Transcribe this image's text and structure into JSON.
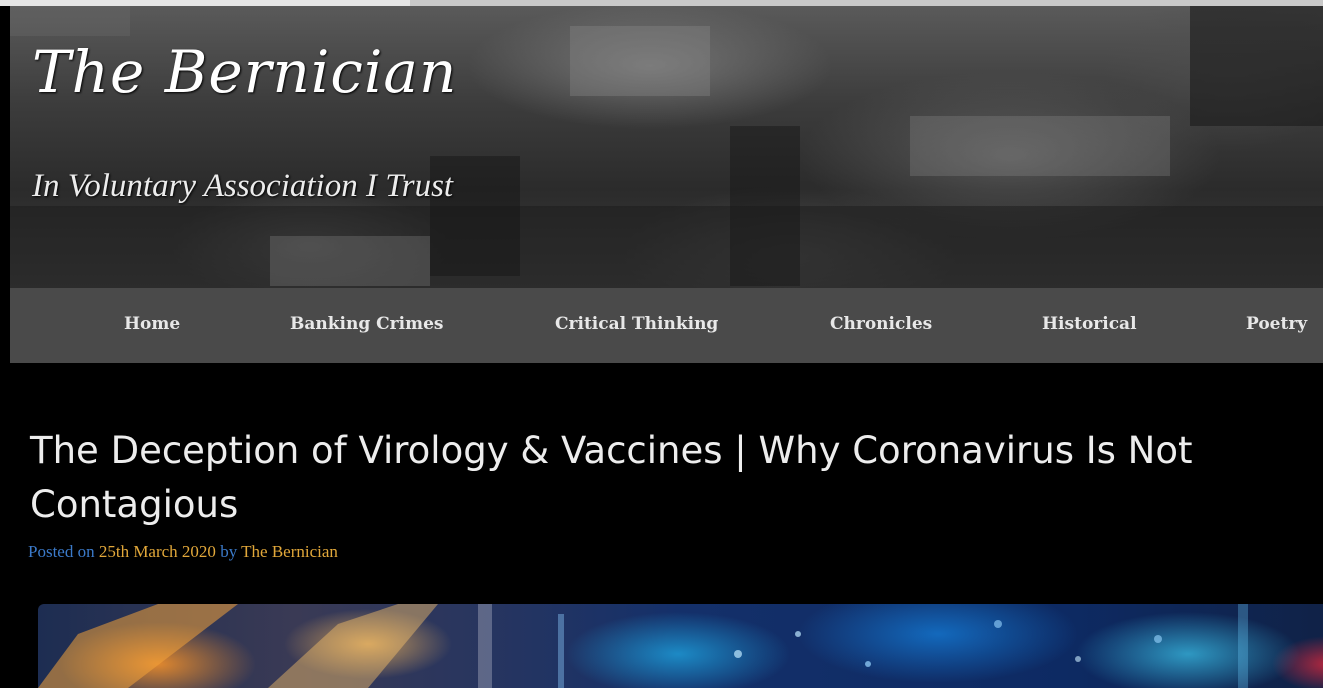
{
  "site": {
    "title": "The Bernician",
    "tagline": "In Voluntary Association I Trust"
  },
  "nav": {
    "items": [
      {
        "label": "Home"
      },
      {
        "label": "Banking Crimes"
      },
      {
        "label": "Critical Thinking"
      },
      {
        "label": "Chronicles"
      },
      {
        "label": "Historical"
      },
      {
        "label": "Poetry"
      }
    ]
  },
  "post": {
    "title": "The Deception of Virology & Vaccines | Why Coronavirus Is Not Contagious",
    "posted_on_label": "Posted on",
    "date": "25th March 2020",
    "by_label": "by",
    "author": "The Bernician"
  },
  "colors": {
    "nav_background": "#4a4a4a",
    "meta_label": "#3b7ac9",
    "meta_link": "#e2a83a",
    "page_background": "#000000"
  }
}
